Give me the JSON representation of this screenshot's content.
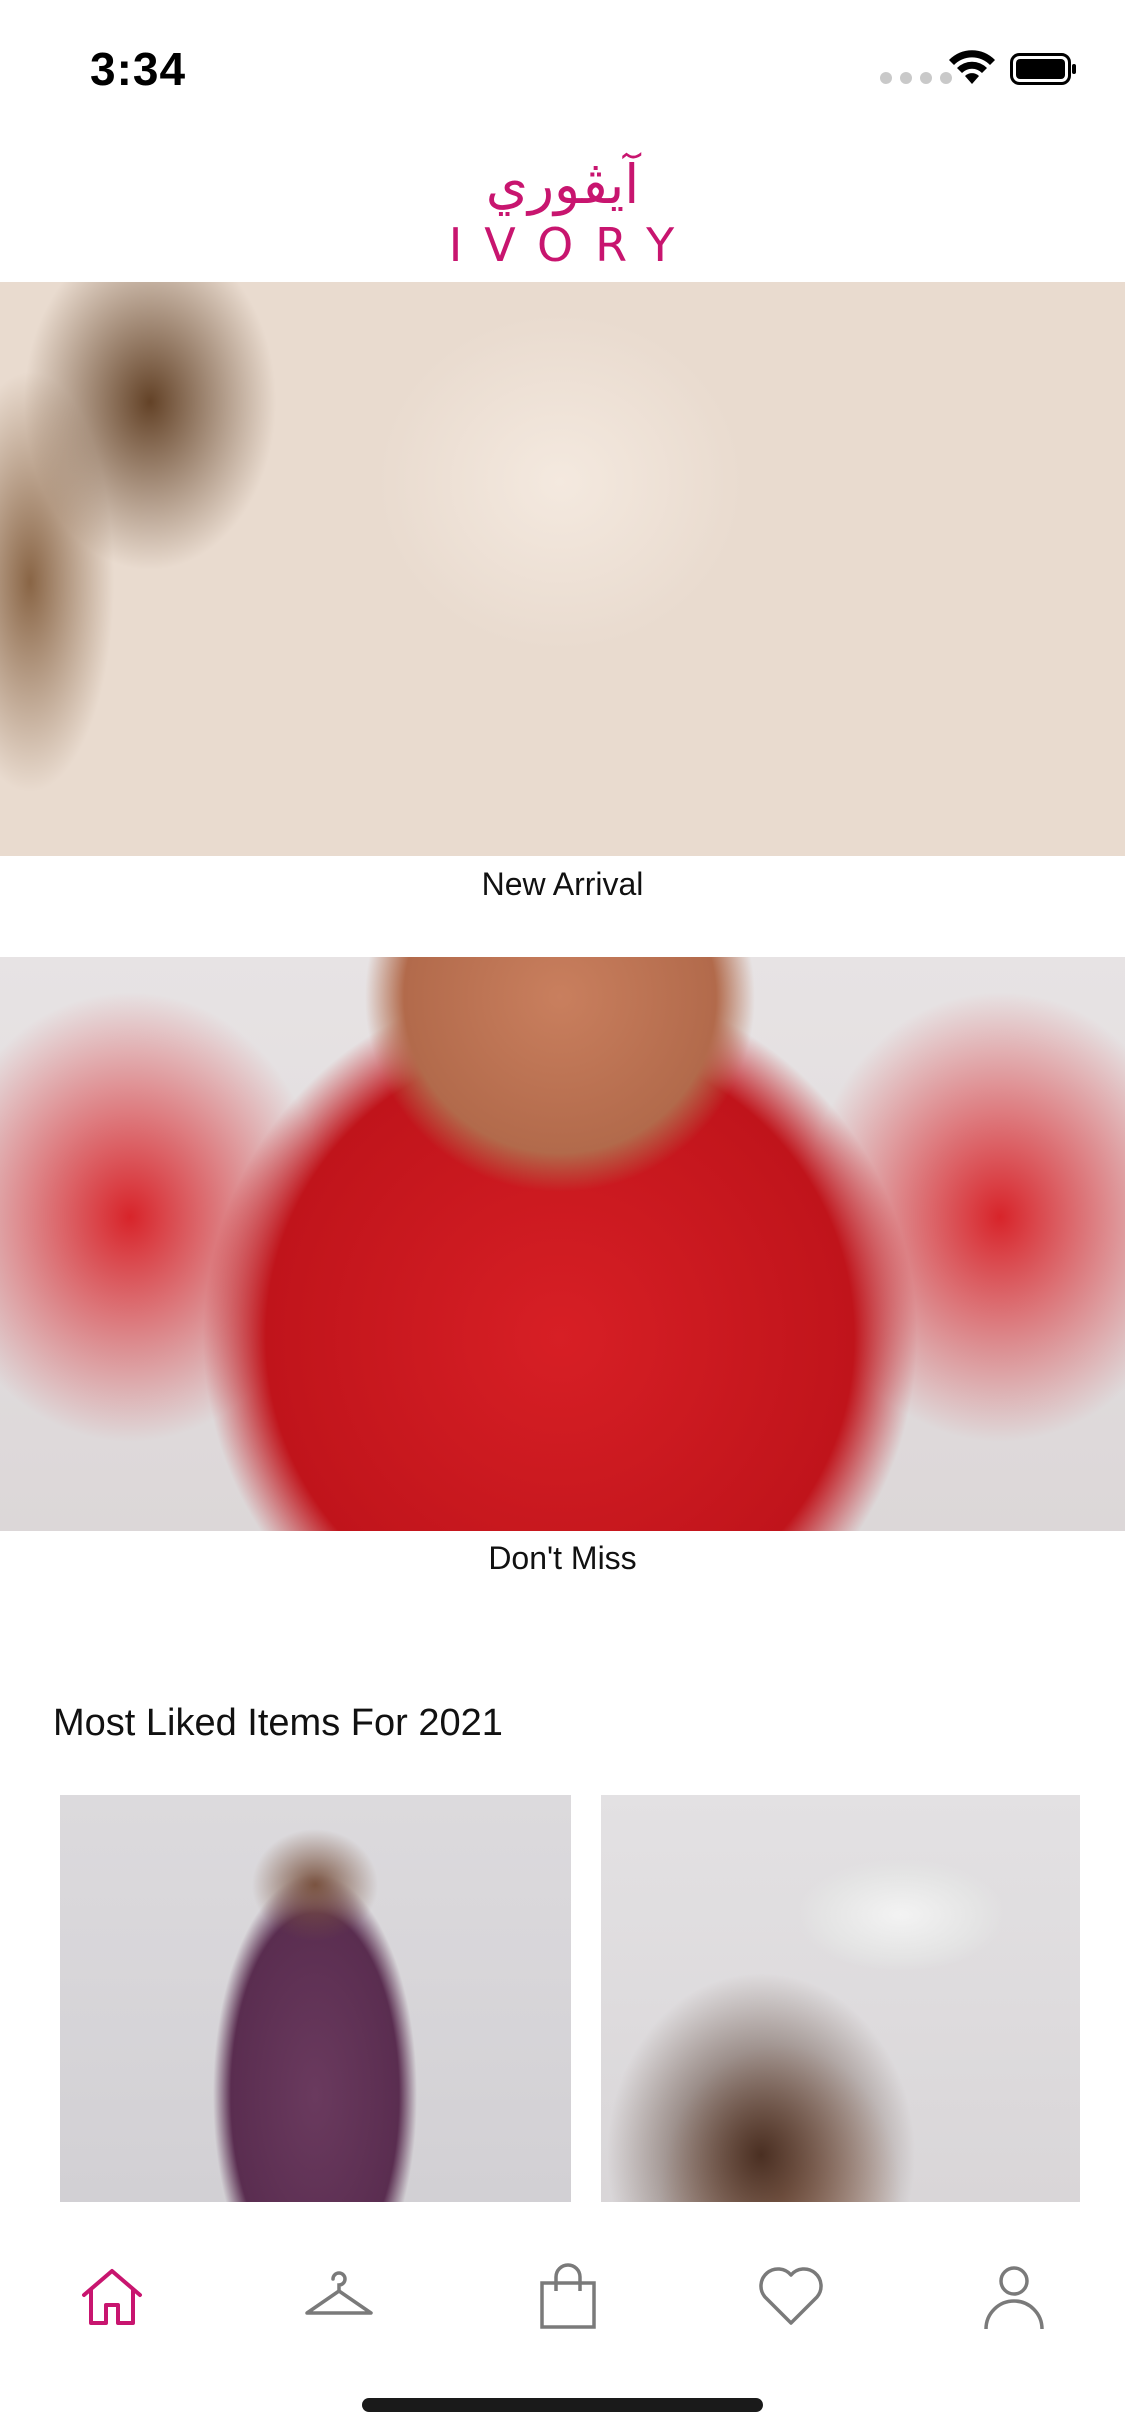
{
  "status_bar": {
    "time": "3:34"
  },
  "header": {
    "logo_arabic": "آيڤوري",
    "logo_latin": "IVORY",
    "brand_color": "#c8156f"
  },
  "banners": [
    {
      "caption": "New Arrival"
    },
    {
      "caption": "Don't Miss"
    }
  ],
  "most_liked": {
    "title": "Most Liked Items For 2021"
  },
  "tab_bar": {
    "active_color": "#c8156f",
    "inactive_color": "#7a7a7a",
    "items": [
      {
        "icon": "home-icon",
        "active": true
      },
      {
        "icon": "hanger-icon",
        "active": false
      },
      {
        "icon": "shopping-bag-icon",
        "active": false
      },
      {
        "icon": "heart-icon",
        "active": false
      },
      {
        "icon": "user-icon",
        "active": false
      }
    ]
  }
}
